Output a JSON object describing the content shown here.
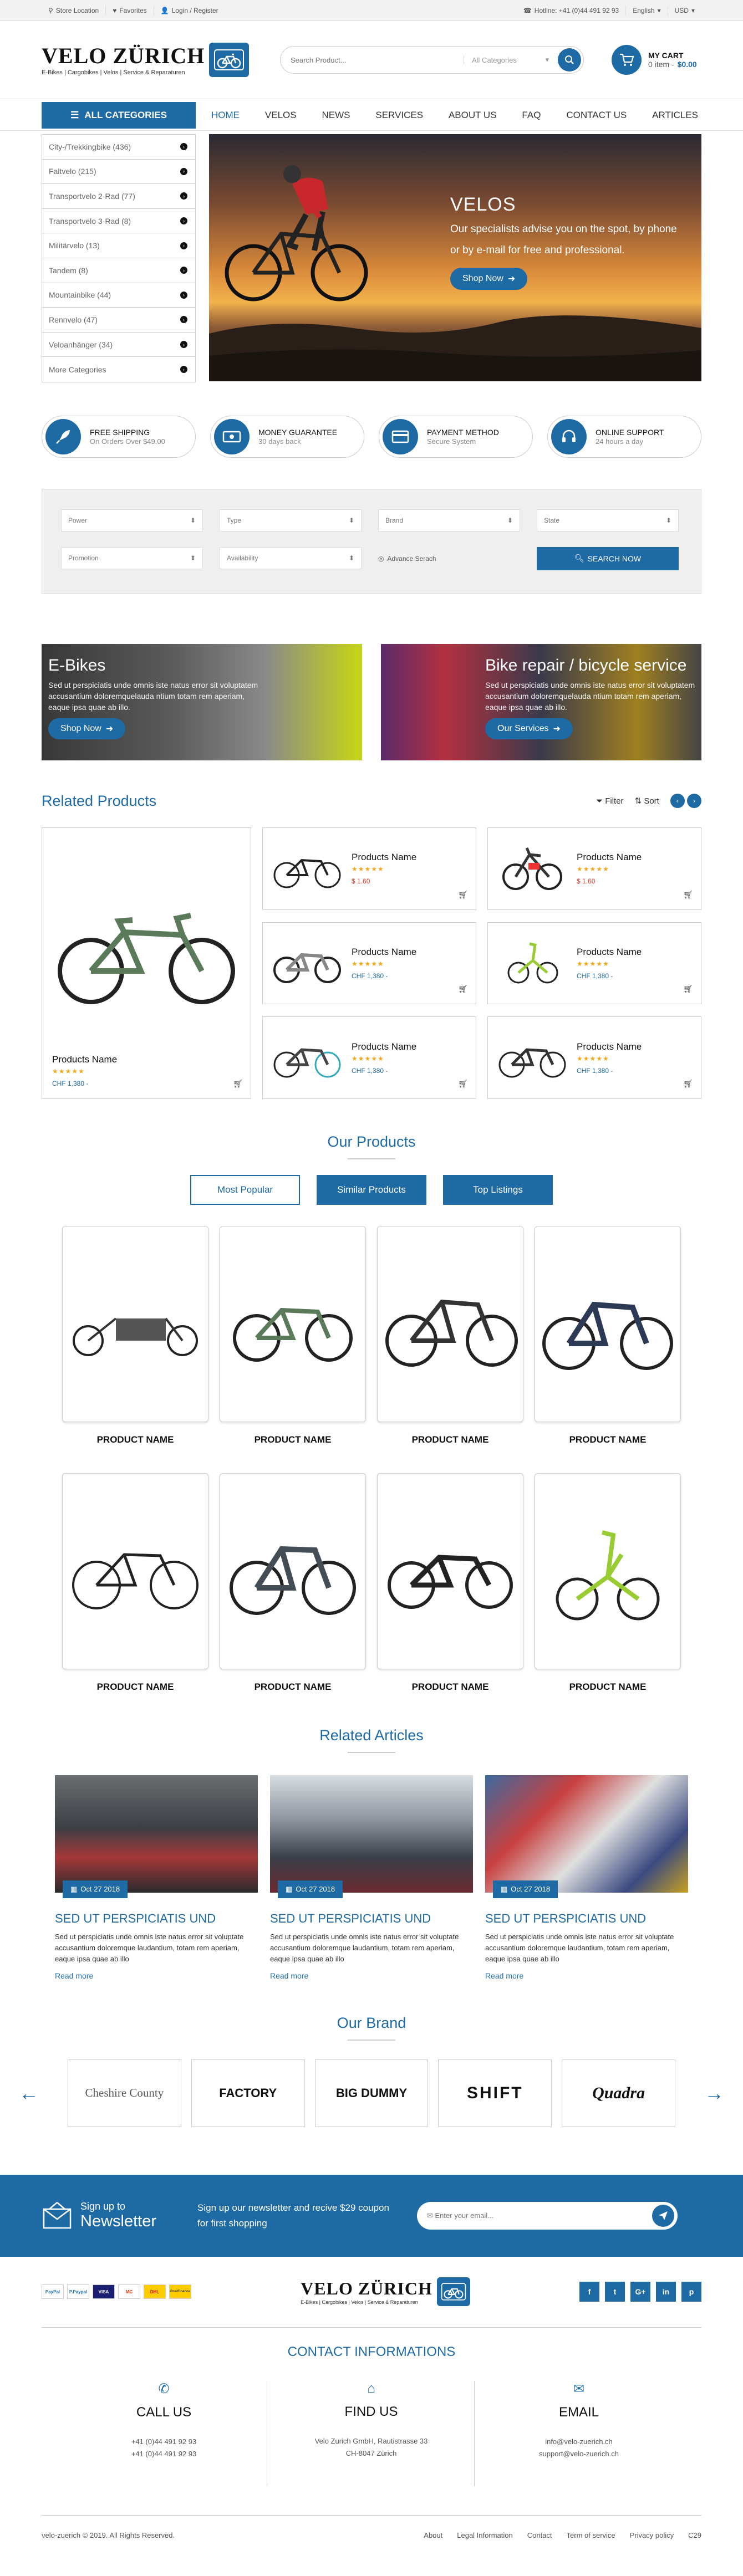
{
  "topbar": {
    "store": "Store Location",
    "favorites": "Favorites",
    "login": "Login / Register",
    "hotline": "Hotline: +41 (0)44 491 92 93",
    "lang": "English",
    "currency": "USD"
  },
  "logo": {
    "name": "VELO ZÜRICH",
    "tagline": "E-Bikes | Cargobikes | Velos | Service & Reparaturen"
  },
  "search": {
    "placeholder": "Search Product...",
    "category": "All Categories"
  },
  "cart": {
    "title": "MY CART",
    "items": "0 item -",
    "total": "$0.00"
  },
  "nav": {
    "allcat": "ALL CATEGORIES",
    "items": [
      "HOME",
      "VELOS",
      "NEWS",
      "SERVICES",
      "ABOUT US",
      "FAQ",
      "CONTACT US",
      "ARTICLES"
    ]
  },
  "categories": [
    "City-/Trekkingbike (436)",
    "Faltvelo (215)",
    "Transportvelo 2-Rad (77)",
    "Transportvelo 3-Rad (8)",
    "Militärvelo (13)",
    "Tandem (8)",
    "Mountainbike (44)",
    "Rennvelo (47)",
    "Veloanhänger (34)",
    "More Categories"
  ],
  "banner": {
    "title": "VELOS",
    "text": "Our specialists advise you on the spot, by phone or by e-mail for free and professional.",
    "button": "Shop Now"
  },
  "features": [
    {
      "title": "FREE SHIPPING",
      "sub": "On Orders Over $49.00",
      "icon": "rocket-icon"
    },
    {
      "title": "MONEY GUARANTEE",
      "sub": "30 days back",
      "icon": "money-icon"
    },
    {
      "title": "PAYMENT METHOD",
      "sub": "Secure System",
      "icon": "credit-card-icon"
    },
    {
      "title": "ONLINE SUPPORT",
      "sub": "24 hours a day",
      "icon": "headset-icon"
    }
  ],
  "filter": {
    "power": "Power",
    "type": "Type",
    "brand": "Brand",
    "state": "State",
    "promotion": "Promotion",
    "availability": "Availability",
    "advanced": "Advance Serach",
    "search": "SEARCH NOW"
  },
  "promos": [
    {
      "title": "E-Bikes",
      "text": "Sed ut perspiciatis unde omnis iste natus error sit voluptatem accusantium doloremquelauda ntium totam rem aperiam, eaque ipsa quae ab illo.",
      "button": "Shop Now"
    },
    {
      "title": "Bike repair / bicycle service",
      "text": "Sed ut perspiciatis unde omnis iste natus error sit voluptatem accusantium doloremquelauda ntium totam rem aperiam, eaque ipsa quae ab illo.",
      "button": "Our Services"
    }
  ],
  "related": {
    "title": "Related Products",
    "filter": "Filter",
    "sort": "Sort",
    "big": {
      "name": "Products Name",
      "price": "CHF 1,380 -"
    },
    "items": [
      {
        "name": "Products Name",
        "price": "$ 1.60",
        "red": true
      },
      {
        "name": "Products Name",
        "price": "$ 1.60",
        "red": true
      },
      {
        "name": "Products Name",
        "price": "CHF 1,380 -",
        "red": false
      },
      {
        "name": "Products Name",
        "price": "CHF 1,380 -",
        "red": false
      },
      {
        "name": "Products Name",
        "price": "CHF 1,380 -",
        "red": false
      },
      {
        "name": "Products Name",
        "price": "CHF 1,380 -",
        "red": false
      }
    ]
  },
  "our_products": {
    "title": "Our Products",
    "tabs": [
      "Most Popular",
      "Similar Products",
      "Top Listings"
    ],
    "items": [
      "PRODUCT NAME",
      "PRODUCT NAME",
      "PRODUCT NAME",
      "PRODUCT NAME",
      "PRODUCT NAME",
      "PRODUCT NAME",
      "PRODUCT NAME",
      "PRODUCT NAME"
    ]
  },
  "articles": {
    "title": "Related Articles",
    "items": [
      {
        "date": "Oct 27 2018",
        "title": "SED UT PERSPICIATIS UND",
        "text": "Sed ut perspiciatis unde omnis iste natus error sit voluptate accusantium doloremque laudantium, totam rem aperiam, eaque ipsa quae ab illo",
        "more": "Read more"
      },
      {
        "date": "Oct 27 2018",
        "title": "SED UT PERSPICIATIS UND",
        "text": "Sed ut perspiciatis unde omnis iste natus error sit voluptate accusantium doloremque laudantium, totam rem aperiam, eaque ipsa quae ab illo",
        "more": "Read more"
      },
      {
        "date": "Oct 27 2018",
        "title": "SED UT PERSPICIATIS UND",
        "text": "Sed ut perspiciatis unde omnis iste natus error sit voluptate accusantium doloremque laudantium, totam rem aperiam, eaque ipsa quae ab illo",
        "more": "Read more"
      }
    ]
  },
  "brands": {
    "title": "Our Brand",
    "items": [
      "Cheshire County",
      "FACTORY",
      "BIG DUMMY",
      "SHIFT",
      "Quadra"
    ]
  },
  "newsletter": {
    "line1": "Sign up to",
    "line2": "Newsletter",
    "desc": "Sign up our newsletter and recive $29 coupon for first shopping",
    "placeholder": "Enter your email..."
  },
  "payments": [
    "PayPal",
    "P.Paypal",
    "VISA",
    "MC",
    "DHL",
    "PostFinance"
  ],
  "socials": [
    "f",
    "t",
    "G+",
    "in",
    "p"
  ],
  "contact": {
    "title": "CONTACT INFORMATIONS",
    "call": {
      "title": "CALL US",
      "l1": "+41 (0)44 491 92 93",
      "l2": "+41 (0)44 491 92 93"
    },
    "find": {
      "title": "FIND US",
      "l1": "Velo Zurich GmbH, Rautistrasse 33",
      "l2": "CH-8047 Zürich"
    },
    "email": {
      "title": "EMAIL",
      "l1": "info@velo-zuerich.ch",
      "l2": "support@velo-zuerich.ch"
    }
  },
  "footer": {
    "copy": "velo-zuerich © 2019. All Rights Reserved.",
    "links": [
      "About",
      "Legal Information",
      "Contact",
      "Term of service",
      "Privacy policy"
    ],
    "code": "C29"
  },
  "colors": {
    "brand": "#1e6aa5",
    "star": "#f3a81a",
    "sale": "#e23a2a"
  }
}
